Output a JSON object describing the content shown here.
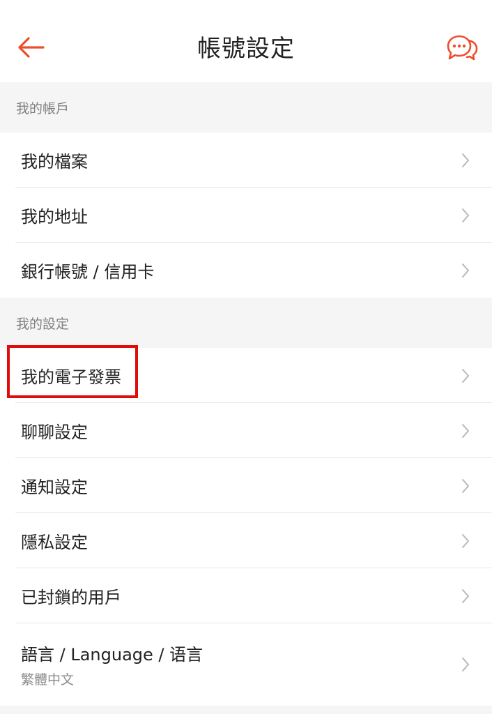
{
  "header": {
    "title": "帳號設定",
    "back_icon": "arrow-left-icon",
    "chat_icon": "chat-bubbles-icon",
    "accent_color": "#ee4d2d"
  },
  "sections": {
    "account": {
      "title": "我的帳戶",
      "items": [
        {
          "label": "我的檔案"
        },
        {
          "label": "我的地址"
        },
        {
          "label": "銀行帳號 / 信用卡"
        }
      ]
    },
    "settings": {
      "title": "我的設定",
      "items": [
        {
          "label": "我的電子發票"
        },
        {
          "label": "聊聊設定"
        },
        {
          "label": "通知設定"
        },
        {
          "label": "隱私設定"
        },
        {
          "label": "已封鎖的用戶"
        },
        {
          "label": "語言 / Language / 语言",
          "sublabel": "繁體中文"
        }
      ]
    }
  },
  "annotation": {
    "highlight_color": "#e00b0b"
  }
}
